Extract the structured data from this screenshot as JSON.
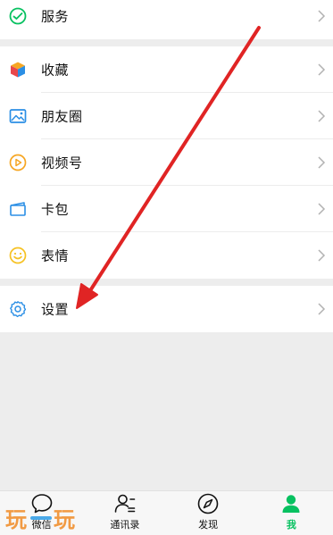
{
  "menu": {
    "group1": [
      {
        "label": "服务",
        "icon": "wechat-pay-icon",
        "color": "#07c160"
      }
    ],
    "group2": [
      {
        "label": "收藏",
        "icon": "favorites-cube-icon"
      },
      {
        "label": "朋友圈",
        "icon": "moments-photo-icon",
        "color": "#2b8fe5"
      },
      {
        "label": "视频号",
        "icon": "channels-play-icon",
        "color": "#f6a623"
      },
      {
        "label": "卡包",
        "icon": "card-wallet-icon",
        "color": "#2b8fe5"
      },
      {
        "label": "表情",
        "icon": "sticker-smile-icon",
        "color": "#f6c224"
      }
    ],
    "group3": [
      {
        "label": "设置",
        "icon": "gear-icon",
        "color": "#2b8fe5"
      }
    ]
  },
  "tabbar": {
    "tabs": [
      {
        "label": "微信",
        "icon": "chat-bubble-icon"
      },
      {
        "label": "通讯录",
        "icon": "contacts-icon"
      },
      {
        "label": "发现",
        "icon": "compass-icon"
      },
      {
        "label": "我",
        "icon": "person-icon",
        "active": true
      }
    ],
    "active_color": "#07c160"
  },
  "annotation": {
    "arrow_color": "#e02424"
  },
  "watermark": {
    "text": "玩一玩"
  }
}
